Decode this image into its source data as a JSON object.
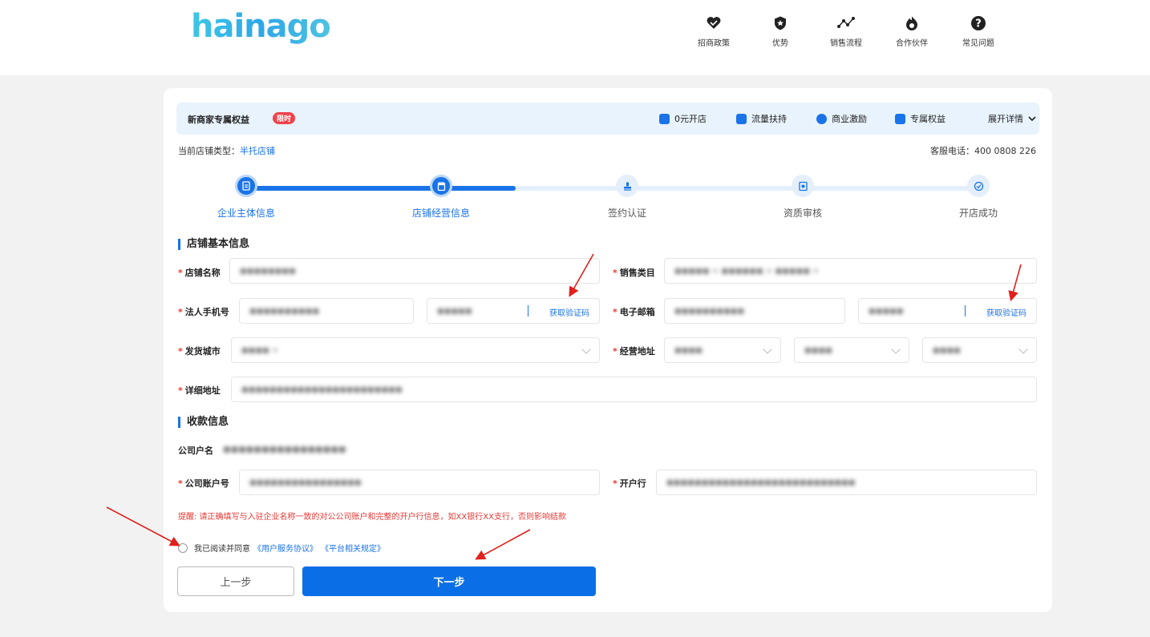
{
  "header": {
    "logo": "hainago",
    "nav": [
      {
        "label": "招商政策",
        "icon": "heart-handshake-icon"
      },
      {
        "label": "优势",
        "icon": "shield-star-icon"
      },
      {
        "label": "销售流程",
        "icon": "flow-line-icon"
      },
      {
        "label": "合作伙伴",
        "icon": "flame-icon"
      },
      {
        "label": "常见问题",
        "icon": "question-icon"
      }
    ]
  },
  "benefits": {
    "title": "新商家专属权益",
    "tag": "限时",
    "items": [
      {
        "label": "0元开店",
        "icon": "store-icon"
      },
      {
        "label": "流量扶持",
        "icon": "check-square-icon"
      },
      {
        "label": "商业激励",
        "icon": "badge-icon"
      },
      {
        "label": "专属权益",
        "icon": "gift-icon"
      }
    ],
    "expand": "展开详情"
  },
  "store_type": {
    "label": "当前店铺类型：",
    "value": "半托店铺"
  },
  "service": "客服电话：400 0808 226",
  "progress_percent": 37,
  "steps": [
    {
      "label": "企业主体信息",
      "state": "done"
    },
    {
      "label": "店铺经营信息",
      "state": "current"
    },
    {
      "label": "签约认证",
      "state": "pending"
    },
    {
      "label": "资质审核",
      "state": "pending"
    },
    {
      "label": "开店成功",
      "state": "pending"
    }
  ],
  "store_info": {
    "title": "店铺基本信息",
    "store_name": {
      "label": "店铺名称",
      "value": "●●●●●●●●"
    },
    "sales_category": {
      "label": "销售类目",
      "value": "●●●●●  ×   ●●●●●●  ×   ●●●●●  ×"
    },
    "phone": {
      "label": "法人手机号",
      "value": "●●●●●●●●●●",
      "code": "●●●●●",
      "get_code": "获取验证码"
    },
    "email": {
      "label": "电子邮箱",
      "value": "●●●●●●●●●●",
      "code": "●●●●●",
      "get_code": "获取验证码"
    },
    "ship_city": {
      "label": "发货城市",
      "value": "●●●●  ×"
    },
    "biz_address": {
      "label": "经营地址",
      "province": "●●●●",
      "city": "●●●●",
      "district": "●●●●"
    },
    "detail_address": {
      "label": "详细地址",
      "value": "●●●●●●●●●●●●●●●●●●●●●●●"
    }
  },
  "payment_info": {
    "title": "收款信息",
    "company_name": {
      "label": "公司户名",
      "value": "●●●●●●●●●●●●●●●●"
    },
    "account": {
      "label": "公司账户号",
      "value": "●●●●●●●●●●●●●●●●"
    },
    "bank": {
      "label": "开户行",
      "value": "●●●●●●●●●●●●●●●●●●●●●●●●●●●"
    },
    "tip": "提醒: 请正确填写与入驻企业名称一致的对公公司账户和完整的开户行信息，如XX银行XX支行，否则影响结款"
  },
  "agreement": {
    "text": "我已阅读并同意",
    "link1": "《用户服务协议》",
    "link2": "《平台相关规定》"
  },
  "buttons": {
    "prev": "上一步",
    "next": "下一步"
  },
  "colors": {
    "primary": "#1a73e8",
    "danger": "#e53935",
    "annotation": "#e0201c"
  }
}
